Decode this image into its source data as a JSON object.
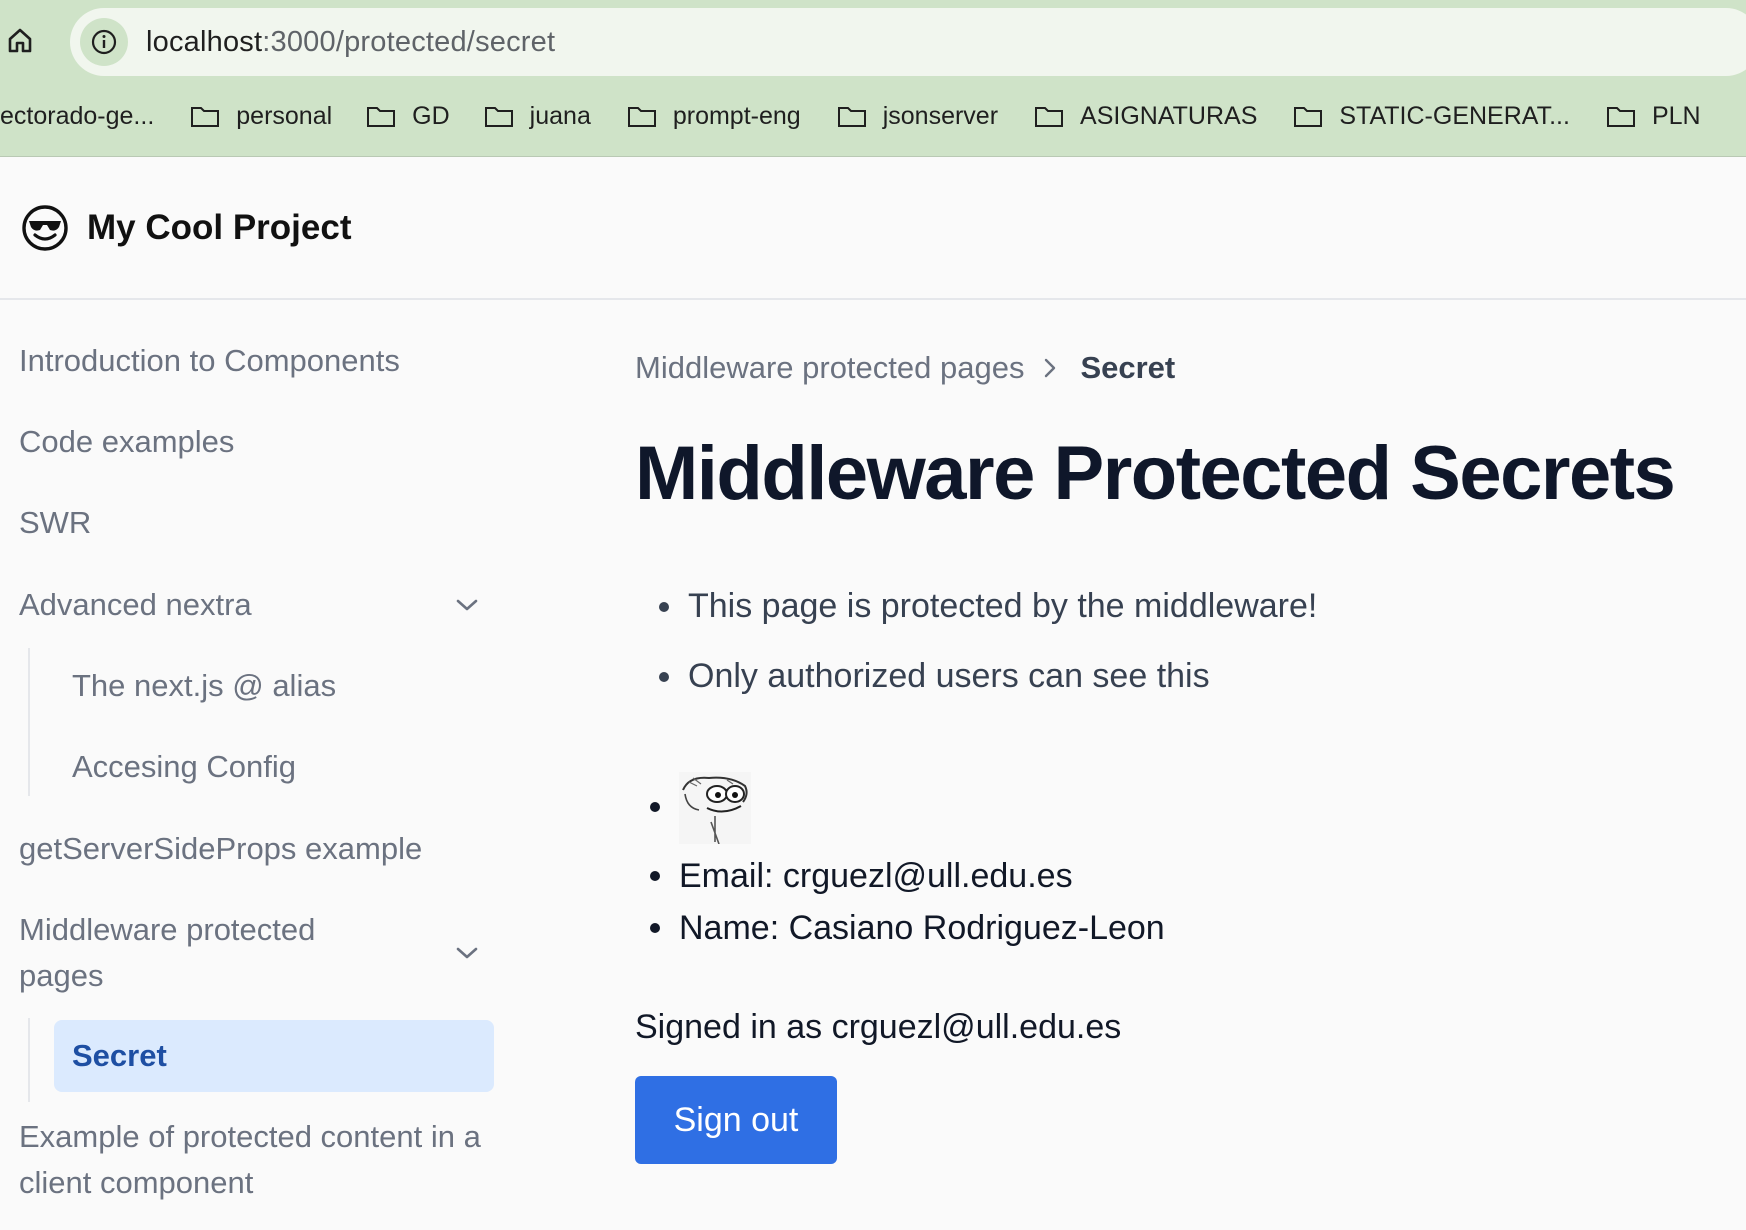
{
  "browser": {
    "url_host": "localhost",
    "url_path": ":3000/protected/secret",
    "bookmarks": [
      {
        "label": "ectorado-ge..."
      },
      {
        "label": "personal"
      },
      {
        "label": "GD"
      },
      {
        "label": "juana"
      },
      {
        "label": "prompt-eng"
      },
      {
        "label": "jsonserver"
      },
      {
        "label": "ASIGNATURAS"
      },
      {
        "label": "STATIC-GENERAT..."
      },
      {
        "label": "PLN"
      }
    ]
  },
  "site": {
    "logo_icon": "sunglasses-smiley-icon",
    "title": "My Cool Project"
  },
  "sidebar": {
    "items": [
      {
        "label": "Introduction to Components"
      },
      {
        "label": "Code examples"
      },
      {
        "label": "SWR"
      },
      {
        "label": "Advanced nextra",
        "expanded": true
      },
      {
        "label": "The next.js @ alias"
      },
      {
        "label": "Accesing Config"
      },
      {
        "label": "getServerSideProps example"
      },
      {
        "label": "Middleware protected pages",
        "expanded": true
      },
      {
        "label": "Secret",
        "active": true
      },
      {
        "label": "Example of protected content in a client component"
      }
    ]
  },
  "main": {
    "breadcrumb": {
      "parent": "Middleware protected pages",
      "current": "Secret"
    },
    "title": "Middleware Protected Secrets",
    "bullets": [
      "This page is protected by the middleware!",
      "Only authorized users can see this"
    ],
    "user": {
      "email_line": "Email: crguezl@ull.edu.es",
      "name_line": "Name: Casiano Rodriguez-Leon"
    },
    "signed_in_text": "Signed in as crguezl@ull.edu.es",
    "sign_out_label": "Sign out"
  },
  "colors": {
    "chrome_bg": "#cfe3c8",
    "accent": "#2f6fe4",
    "active_bg": "#dbeafe",
    "active_text": "#1e4fa3"
  }
}
